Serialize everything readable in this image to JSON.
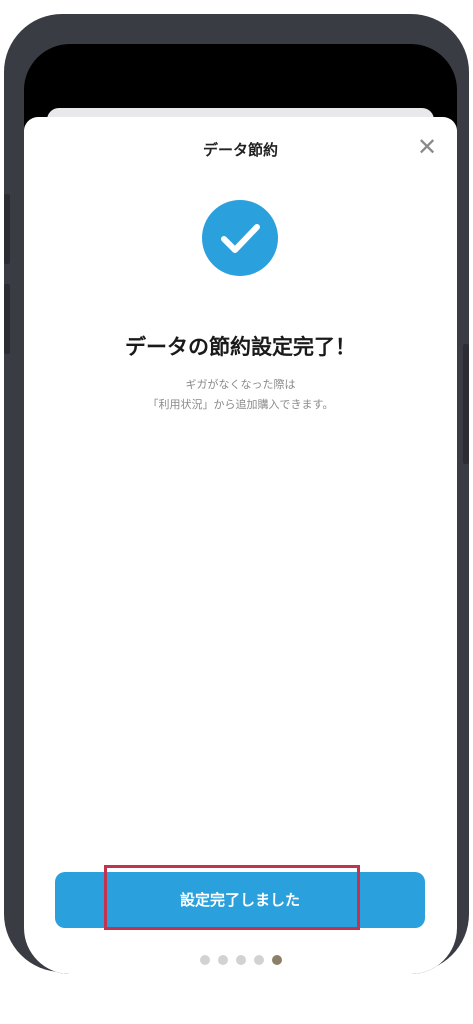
{
  "sheet": {
    "title": "データ節約",
    "close_icon": "close-icon"
  },
  "success": {
    "icon": "checkmark-circle-icon",
    "icon_color": "#2aa0dc",
    "heading": "データの節約設定完了！",
    "message_line1": "ギガがなくなった際は",
    "message_line2": "「利用状況」から追加購入できます。"
  },
  "actions": {
    "primary_label": "設定完了しました",
    "primary_color": "#2aa0dc",
    "highlight_color": "#c2344e"
  },
  "pagination": {
    "total": 5,
    "current": 5,
    "active_color": "#8c8069",
    "inactive_color": "#d2d2d2"
  }
}
